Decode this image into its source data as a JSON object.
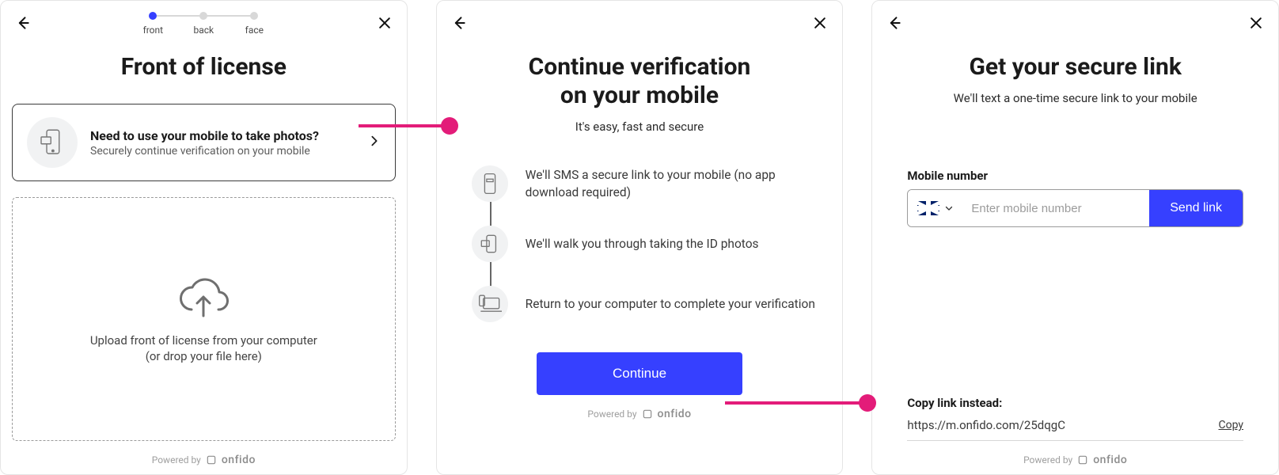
{
  "stepper": {
    "steps": [
      {
        "label": "front",
        "active": true
      },
      {
        "label": "back",
        "active": false
      },
      {
        "label": "face",
        "active": false
      }
    ]
  },
  "panel1": {
    "title": "Front of license",
    "mobile_card": {
      "title": "Need to use your mobile to take photos?",
      "subtitle": "Securely continue verification on your mobile"
    },
    "upload": {
      "line1": "Upload front of license from your computer",
      "line2": "(or drop your file here)"
    }
  },
  "panel2": {
    "title_line1": "Continue verification",
    "title_line2": "on your mobile",
    "subtitle": "It's easy, fast and secure",
    "steps": [
      "We'll SMS a secure link to your mobile (no app download required)",
      "We'll walk you through taking the ID photos",
      "Return to your computer to complete your verification"
    ],
    "continue_label": "Continue"
  },
  "panel3": {
    "title": "Get your secure link",
    "subtitle": "We'll text a one-time secure link to your mobile",
    "mobile_label": "Mobile number",
    "mobile_placeholder": "Enter mobile number",
    "send_label": "Send link",
    "country_code": "GB",
    "copy_section": {
      "title": "Copy link instead:",
      "url": "https://m.onfido.com/25dqgC",
      "copy_label": "Copy"
    }
  },
  "footer": {
    "powered_by": "Powered by",
    "brand": "onfido"
  },
  "colors": {
    "primary": "#3640ff",
    "accent": "#e31c79"
  }
}
